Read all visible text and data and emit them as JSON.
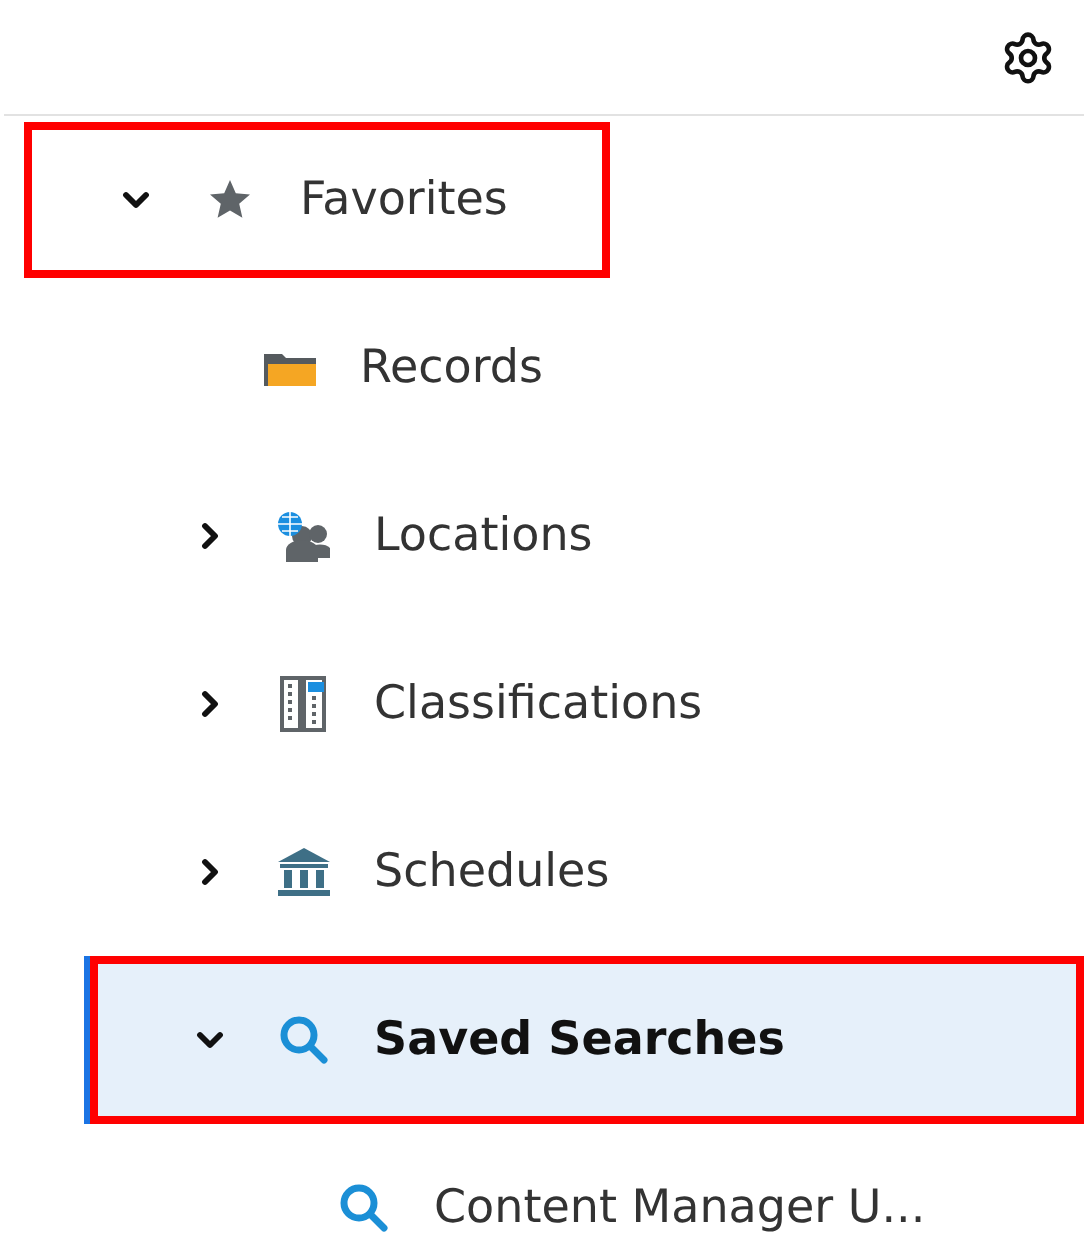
{
  "toolbar": {
    "settings": true
  },
  "tree": [
    {
      "label": "Favorites",
      "kind": "star",
      "expanded": true,
      "selected": false,
      "highlighted": true,
      "children": [
        {
          "label": "Records",
          "kind": "folder",
          "selected": false,
          "highlighted": false
        },
        {
          "label": "Locations",
          "kind": "locations",
          "expanded": false,
          "selected": false,
          "highlighted": false
        },
        {
          "label": "Classifications",
          "kind": "classification",
          "expanded": false,
          "selected": false,
          "highlighted": false
        },
        {
          "label": "Schedules",
          "kind": "schedule",
          "expanded": false,
          "selected": false,
          "highlighted": false
        },
        {
          "label": "Saved Searches",
          "kind": "search",
          "expanded": true,
          "selected": true,
          "highlighted": true,
          "children": [
            {
              "label": "Content Manager U...",
              "kind": "search",
              "selected": false,
              "highlighted": false
            }
          ]
        }
      ]
    }
  ]
}
